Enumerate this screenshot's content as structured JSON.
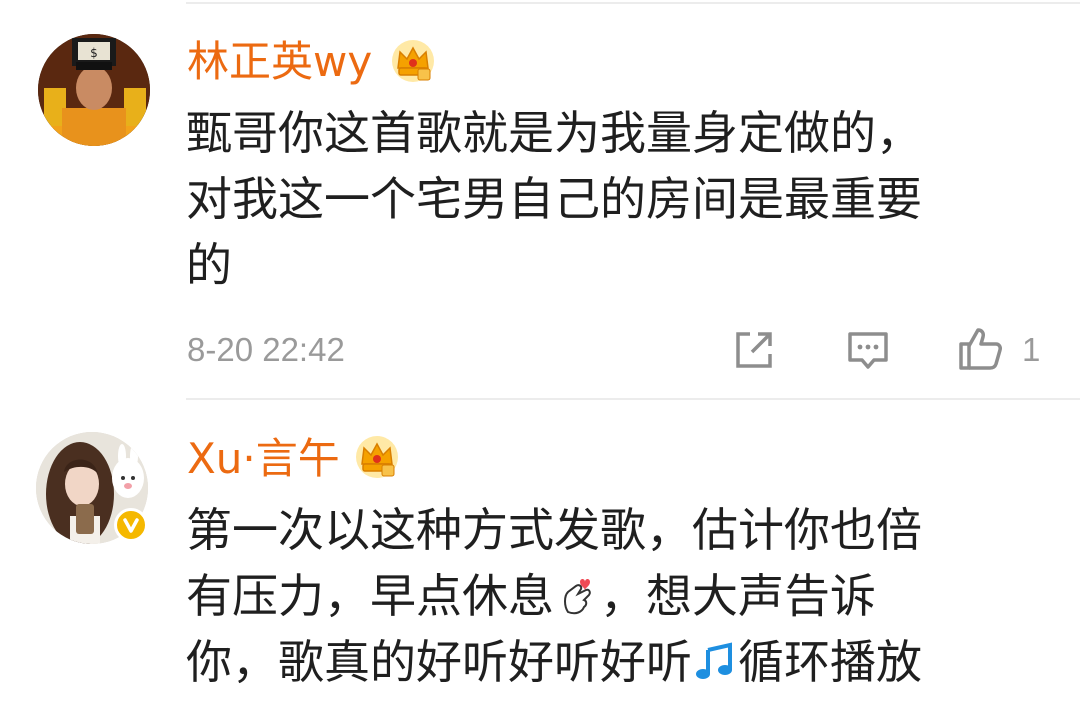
{
  "comments": [
    {
      "username": "林正英wy",
      "vip_icon": "crown-vip-icon",
      "lines": [
        "甄哥你这首歌就是为我量身定做的，",
        "对我这一个宅男自己的房间是最重要",
        "的"
      ],
      "time": "8-20 22:42",
      "actions": [
        "share-icon",
        "comment-icon",
        "like-icon"
      ],
      "like_count": "1"
    },
    {
      "username": "Xu·言午",
      "vip_icon": "crown-vip-icon",
      "verified_badge": "verified-v-icon",
      "lines": [
        {
          "before": "第一次以这种方式发歌，估计你也倍"
        },
        {
          "before": "有压力，早点休息",
          "emoji": "finger-heart-emoji",
          "after": "，想大声告诉"
        },
        {
          "before": "你，歌真的好听好听好听",
          "emoji": "music-note-emoji",
          "after": "循环播放"
        }
      ]
    }
  ],
  "colors": {
    "username": "#ec6a11",
    "text": "#1f1f1f",
    "meta": "#9a9a9a",
    "divider": "#ececec",
    "verified": "#f5b800"
  }
}
